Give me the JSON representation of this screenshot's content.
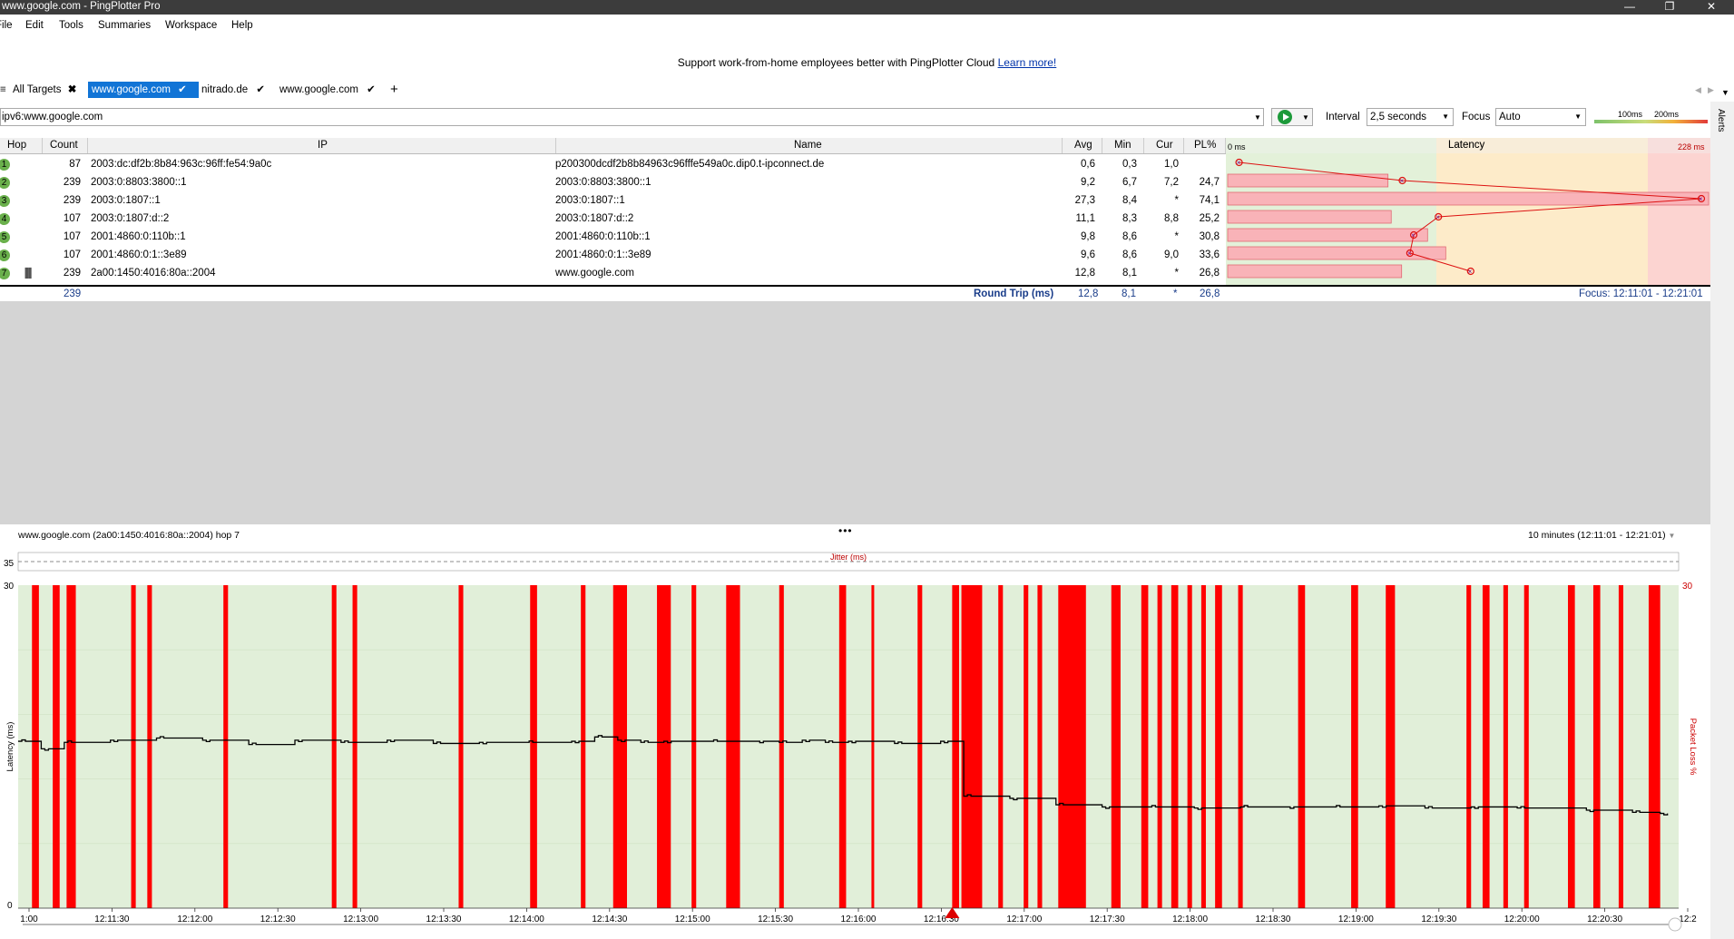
{
  "window": {
    "title": "www.google.com - PingPlotter Pro"
  },
  "menu": [
    "File",
    "Edit",
    "Tools",
    "Summaries",
    "Workspace",
    "Help"
  ],
  "banner": {
    "text": "Support work-from-home employees better with PingPlotter Cloud",
    "link": "Learn more!"
  },
  "tabs": [
    {
      "label": "All Targets",
      "icon": "close-icon",
      "active": false
    },
    {
      "label": "www.google.com",
      "icon": "check-icon",
      "active": true
    },
    {
      "label": "nitrado.de",
      "icon": "check-icon",
      "active": false
    },
    {
      "label": "www.google.com",
      "icon": "check-icon",
      "active": false
    }
  ],
  "target": {
    "value": "ipv6:www.google.com"
  },
  "controls": {
    "interval_label": "Interval",
    "interval_value": "2,5 seconds",
    "focus_label": "Focus",
    "focus_value": "Auto",
    "legend_100": "100ms",
    "legend_200": "200ms",
    "alerts_label": "Alerts"
  },
  "table": {
    "headers": {
      "hop": "Hop",
      "count": "Count",
      "ip": "IP",
      "name": "Name",
      "avg": "Avg",
      "min": "Min",
      "cur": "Cur",
      "pl": "PL%",
      "latency": "Latency",
      "lat_min": "0 ms",
      "lat_max": "228 ms"
    },
    "rows": [
      {
        "hop": "1",
        "count": "87",
        "ip": "2003:dc:df2b:8b84:963c:96ff:fe54:9a0c",
        "name": "p200300dcdf2b8b84963c96fffe549a0c.dip0.t-ipconnect.de",
        "avg": "0,6",
        "min": "0,3",
        "cur": "1,0",
        "pl": "",
        "avg_ms": 0.6,
        "pl_pct": 0
      },
      {
        "hop": "2",
        "count": "239",
        "ip": "2003:0:8803:3800::1",
        "name": "2003:0:8803:3800::1",
        "avg": "9,2",
        "min": "6,7",
        "cur": "7,2",
        "pl": "24,7",
        "avg_ms": 9.2,
        "pl_pct": 24.7
      },
      {
        "hop": "3",
        "count": "239",
        "ip": "2003:0:1807::1",
        "name": "2003:0:1807::1",
        "avg": "27,3",
        "min": "8,4",
        "cur": "*",
        "pl": "74,1",
        "avg_ms": 27.3,
        "pl_pct": 74.1
      },
      {
        "hop": "4",
        "count": "107",
        "ip": "2003:0:1807:d::2",
        "name": "2003:0:1807:d::2",
        "avg": "11,1",
        "min": "8,3",
        "cur": "8,8",
        "pl": "25,2",
        "avg_ms": 11.1,
        "pl_pct": 25.2
      },
      {
        "hop": "5",
        "count": "107",
        "ip": "2001:4860:0:110b::1",
        "name": "2001:4860:0:110b::1",
        "avg": "9,8",
        "min": "8,6",
        "cur": "*",
        "pl": "30,8",
        "avg_ms": 9.8,
        "pl_pct": 30.8
      },
      {
        "hop": "6",
        "count": "107",
        "ip": "2001:4860:0:1::3e89",
        "name": "2001:4860:0:1::3e89",
        "avg": "9,6",
        "min": "8,6",
        "cur": "9,0",
        "pl": "33,6",
        "avg_ms": 9.6,
        "pl_pct": 33.6
      },
      {
        "hop": "7",
        "count": "239",
        "ip": "2a00:1450:4016:80a::2004",
        "name": "www.google.com",
        "avg": "12,8",
        "min": "8,1",
        "cur": "*",
        "pl": "26,8",
        "avg_ms": 12.8,
        "pl_pct": 26.8
      }
    ],
    "summary": {
      "count": "239",
      "label": "Round Trip (ms)",
      "avg": "12,8",
      "min": "8,1",
      "cur": "*",
      "pl": "26,8",
      "focus": "Focus: 12:11:01 - 12:21:01"
    }
  },
  "graph": {
    "title": "www.google.com (2a00:1450:4016:80a::2004) hop 7",
    "range": "10 minutes (12:11:01 - 12:21:01)",
    "jitter_label": "Jitter (ms)",
    "ylabel": "Latency (ms)",
    "y2label": "Packet Loss %",
    "ytop": "30",
    "ybottom": "0",
    "jitter_max": "35",
    "y2top": "30",
    "xticks": [
      "1:00",
      "12:11:30",
      "12:12:00",
      "12:12:30",
      "12:13:00",
      "12:13:30",
      "12:14:00",
      "12:14:30",
      "12:15:00",
      "12:15:30",
      "12:16:00",
      "12:16:30",
      "12:17:00",
      "12:17:30",
      "12:18:00",
      "12:18:30",
      "12:19:00",
      "12:19:30",
      "12:20:00",
      "12:20:30",
      "12:2"
    ],
    "colors": {
      "good": "#e1efd9",
      "loss": "#ff0000",
      "line": "#000000"
    }
  },
  "chart_data": {
    "type": "bar",
    "title": "www.google.com (2a00:1450:4016:80a::2004) hop 7",
    "xlabel": "",
    "ylabel": "Latency (ms)",
    "ylim": [
      0,
      30
    ],
    "x_start": "12:11:01",
    "x_end": "12:21:01",
    "packet_loss_periods_sec": [
      [
        6,
        9
      ],
      [
        15,
        18
      ],
      [
        21,
        25
      ],
      [
        49,
        51
      ],
      [
        56,
        58
      ],
      [
        89,
        91
      ],
      [
        136,
        138
      ],
      [
        145,
        147
      ],
      [
        191,
        193
      ],
      [
        222,
        225
      ],
      [
        244,
        246
      ],
      [
        258,
        264
      ],
      [
        277,
        283
      ],
      [
        292,
        294
      ],
      [
        307,
        313
      ],
      [
        330,
        332
      ],
      [
        356,
        359
      ],
      [
        370,
        371
      ],
      [
        390,
        392
      ],
      [
        405,
        408
      ],
      [
        409,
        418
      ],
      [
        425,
        427
      ],
      [
        436,
        438
      ],
      [
        442,
        444
      ],
      [
        451,
        463
      ],
      [
        474,
        478
      ],
      [
        487,
        490
      ],
      [
        494,
        496
      ],
      [
        500,
        503
      ],
      [
        507,
        509
      ],
      [
        513,
        515
      ],
      [
        519,
        522
      ],
      [
        529,
        531
      ],
      [
        555,
        558
      ],
      [
        578,
        581
      ],
      [
        593,
        597
      ],
      [
        628,
        630
      ],
      [
        635,
        638
      ],
      [
        644,
        646
      ],
      [
        653,
        655
      ],
      [
        672,
        675
      ],
      [
        683,
        686
      ],
      [
        694,
        696
      ],
      [
        707,
        712
      ]
    ],
    "latency_series": [
      {
        "name": "Latency (ms)",
        "t_sec": [
          0,
          10,
          20,
          40,
          60,
          80,
          100,
          120,
          140,
          160,
          180,
          200,
          220,
          240,
          250,
          260,
          270,
          280,
          300,
          320,
          330,
          340,
          350,
          360,
          380,
          400,
          410,
          430,
          450,
          470,
          490,
          510,
          530,
          550,
          570,
          590,
          610,
          630,
          650,
          680,
          700,
          712
        ],
        "ms": [
          15.5,
          14.8,
          15.4,
          15.6,
          15.8,
          15.6,
          15.2,
          15.6,
          15.4,
          15.6,
          15.3,
          15.4,
          15.4,
          15.5,
          15.9,
          15.6,
          15.4,
          15.5,
          15.5,
          15.5,
          15.4,
          15.6,
          15.4,
          15.5,
          15.3,
          15.5,
          10.4,
          10.2,
          9.6,
          9.4,
          9.4,
          9.3,
          9.4,
          9.4,
          9.4,
          9.5,
          9.3,
          9.4,
          9.3,
          9.1,
          8.9,
          8.8
        ]
      }
    ]
  }
}
